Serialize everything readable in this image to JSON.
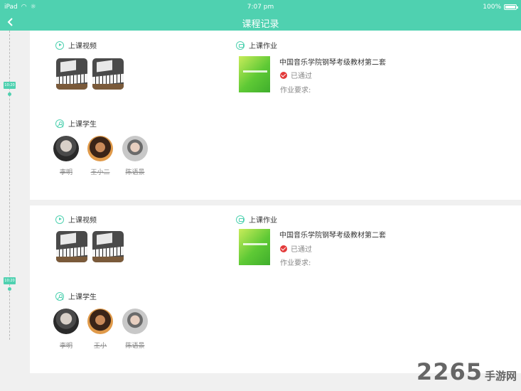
{
  "status_bar": {
    "device": "iPad",
    "time": "7:07 pm",
    "battery": "100%"
  },
  "nav": {
    "title": "课程记录"
  },
  "timeline": {
    "tag1": "10:20",
    "tag2": "10:20"
  },
  "sections": {
    "video": "上课视频",
    "homework": "上课作业",
    "students": "上课学生"
  },
  "records": [
    {
      "homework": {
        "title": "中国音乐学院钢琴考级教材第二套",
        "status": "已通过",
        "requirement": "作业要求:"
      },
      "students": [
        {
          "name": "李明"
        },
        {
          "name": "王小二"
        },
        {
          "name": "陈语景"
        }
      ]
    },
    {
      "homework": {
        "title": "中国音乐学院钢琴考级教材第二套",
        "status": "已通过",
        "requirement": "作业要求:"
      },
      "students": [
        {
          "name": "李明"
        },
        {
          "name": "王小"
        },
        {
          "name": "陈语景"
        }
      ]
    }
  ],
  "watermark": {
    "number": "2265",
    "text": "手游网"
  },
  "colors": {
    "accent": "#4fd1b0",
    "badge": "#e33a3a"
  }
}
